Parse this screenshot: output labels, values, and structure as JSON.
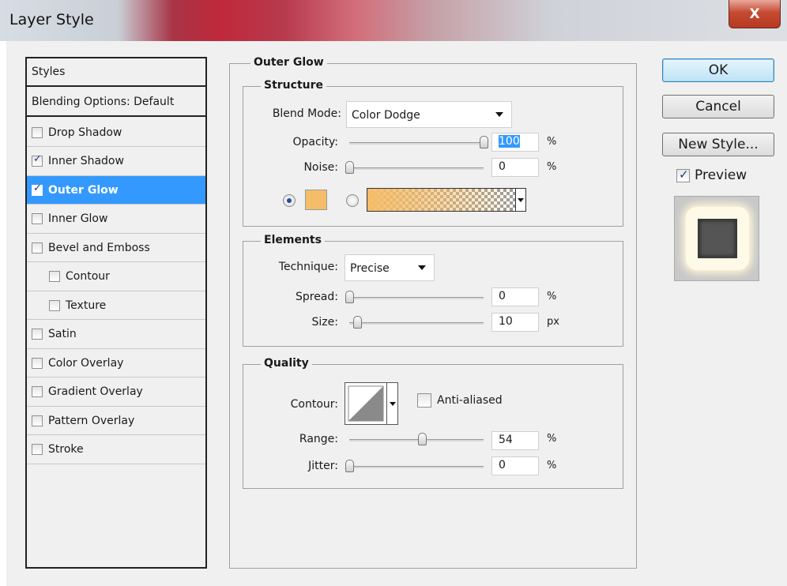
{
  "window": {
    "title": "Layer Style",
    "close_glyph": "X"
  },
  "styles_list": {
    "heading": "Styles",
    "blending": "Blending Options: Default",
    "items": [
      {
        "label": "Drop Shadow",
        "checked": false,
        "indent": false
      },
      {
        "label": "Inner Shadow",
        "checked": true,
        "indent": false
      },
      {
        "label": "Outer Glow",
        "checked": true,
        "indent": false,
        "selected": true
      },
      {
        "label": "Inner Glow",
        "checked": false,
        "indent": false
      },
      {
        "label": "Bevel and Emboss",
        "checked": false,
        "indent": false
      },
      {
        "label": "Contour",
        "checked": false,
        "indent": true
      },
      {
        "label": "Texture",
        "checked": false,
        "indent": true
      },
      {
        "label": "Satin",
        "checked": false,
        "indent": false
      },
      {
        "label": "Color Overlay",
        "checked": false,
        "indent": false
      },
      {
        "label": "Gradient Overlay",
        "checked": false,
        "indent": false
      },
      {
        "label": "Pattern Overlay",
        "checked": false,
        "indent": false
      },
      {
        "label": "Stroke",
        "checked": false,
        "indent": false
      }
    ]
  },
  "outer_glow": {
    "title": "Outer Glow",
    "structure": {
      "title": "Structure",
      "blend_mode_label": "Blend Mode:",
      "blend_mode_value": "Color Dodge",
      "opacity_label": "Opacity:",
      "opacity_value": "100",
      "opacity_unit": "%",
      "opacity_level": 1.0,
      "noise_label": "Noise:",
      "noise_value": "0",
      "noise_unit": "%",
      "noise_level": 0.0,
      "color_swatch": "#f5bd6a",
      "gradient_from": "#f5bd6a"
    },
    "elements": {
      "title": "Elements",
      "technique_label": "Technique:",
      "technique_value": "Precise",
      "spread_label": "Spread:",
      "spread_value": "0",
      "spread_unit": "%",
      "spread_level": 0.0,
      "size_label": "Size:",
      "size_value": "10",
      "size_unit": "px",
      "size_level": 0.06
    },
    "quality": {
      "title": "Quality",
      "contour_label": "Contour:",
      "anti_aliased_label": "Anti-aliased",
      "anti_aliased_checked": false,
      "range_label": "Range:",
      "range_value": "54",
      "range_unit": "%",
      "range_level": 0.54,
      "jitter_label": "Jitter:",
      "jitter_value": "0",
      "jitter_unit": "%",
      "jitter_level": 0.0
    }
  },
  "buttons": {
    "ok": "OK",
    "cancel": "Cancel",
    "new_style": "New Style..."
  },
  "preview": {
    "label": "Preview",
    "checked": true
  }
}
